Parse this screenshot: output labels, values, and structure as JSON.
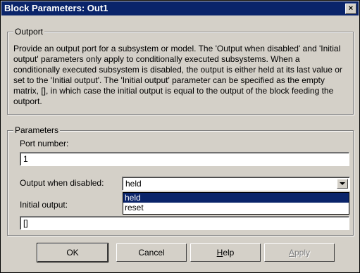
{
  "window": {
    "title": "Block Parameters: Out1",
    "close_glyph": "×"
  },
  "outport": {
    "legend": "Outport",
    "description": "Provide an output port for a subsystem or model.  The 'Output when disabled' and 'Initial output' parameters only apply to conditionally executed subsystems. When a conditionally executed subsystem is disabled, the output is either held at its last value or set to the 'Initial output'. The 'Initial output' parameter can be specified as the empty matrix, [], in which case the initial output is equal to the output of the block feeding the outport."
  },
  "parameters": {
    "legend": "Parameters",
    "port_number_label": "Port number:",
    "port_number_value": "1",
    "output_disabled_label": "Output when disabled:",
    "output_disabled_value": "held",
    "output_disabled_options": [
      "held",
      "reset"
    ],
    "initial_output_label": "Initial output:",
    "initial_output_value": "[]"
  },
  "buttons": {
    "ok": "OK",
    "cancel": "Cancel",
    "help_mnemonic": "H",
    "help_rest": "elp",
    "apply_mnemonic": "A",
    "apply_rest": "pply"
  }
}
